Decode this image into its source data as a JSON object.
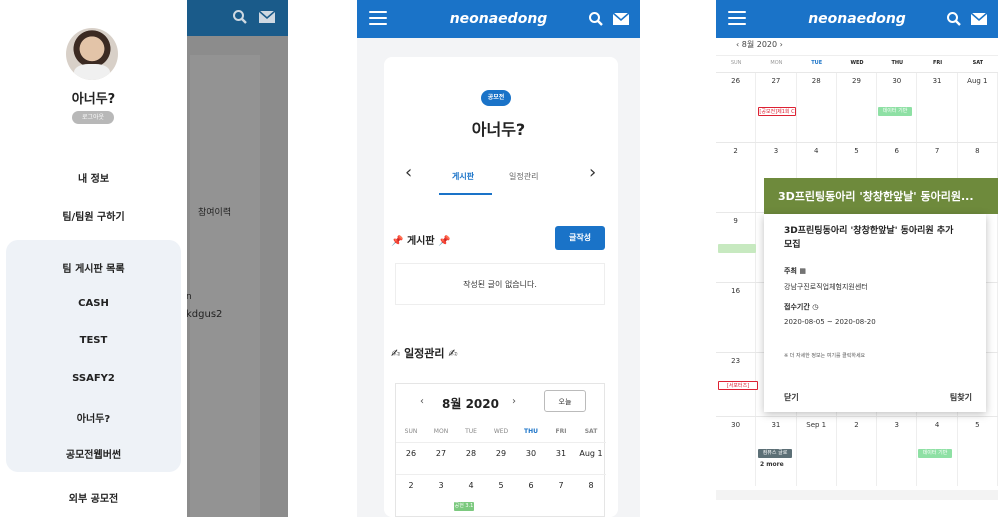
{
  "panel1": {
    "drawer": {
      "user_name": "아너두?",
      "logout_label": "로그아웃",
      "items": [
        "내 정보",
        "팀/팀원 구하기",
        "팀 게시판 목록",
        "CASH",
        "TEST",
        "SSAFY2",
        "아너두?",
        "공모전웹버썬",
        "외부 공모전"
      ]
    },
    "background": {
      "text_1": "참여이력",
      "text_2": "n",
      "text_3": "kdgus2"
    },
    "icons": [
      "search-icon",
      "mail-icon"
    ]
  },
  "panel2": {
    "app_title": "neonaedong",
    "badge": "공모전",
    "team_title": "아너두?",
    "tabs": [
      "게시판",
      "일정관리"
    ],
    "board_heading": "게시판",
    "write_button": "글작성",
    "empty_message": "작성된 글이 없습니다.",
    "schedule_heading": "일정관리",
    "calendar": {
      "prev": "‹",
      "month": "8월 2020",
      "next": "›",
      "today": "오늘",
      "dow": [
        "SUN",
        "MON",
        "TUE",
        "WED",
        "THU",
        "FRI",
        "SAT"
      ],
      "week1": [
        "26",
        "27",
        "28",
        "29",
        "30",
        "31",
        "Aug 1"
      ],
      "week2": [
        "2",
        "3",
        "4",
        "5",
        "6",
        "7",
        "8"
      ],
      "event_label": "공헌 3.1"
    }
  },
  "panel3": {
    "app_title": "neonaedong",
    "subhead": "‹ 8월 2020 ›",
    "dow": [
      "SUN",
      "MON",
      "TUE",
      "WED",
      "THU",
      "FRI",
      "SAT"
    ],
    "weeks": [
      [
        "26",
        "27",
        "28",
        "29",
        "30",
        "31",
        "Aug 1"
      ],
      [
        "2",
        "3",
        "4",
        "5",
        "6",
        "7",
        "8"
      ],
      [
        "9",
        "",
        "",
        "",
        "",
        "",
        ""
      ],
      [
        "16",
        "",
        "",
        "",
        "",
        "",
        ""
      ],
      [
        "23",
        "",
        "",
        "",
        "",
        "",
        ""
      ],
      [
        "30",
        "31",
        "Sep 1",
        "2",
        "3",
        "4",
        "5"
      ]
    ],
    "events": {
      "e1": "[공모전]제1회 C",
      "e2": "데이터 기반",
      "e3": "[서포터즈]",
      "e4": "컴퓨스 글로",
      "e4_more": "2 more",
      "e5": "데이터 기반"
    },
    "popup": {
      "header": "3D프린팅동아리 '창창한앞날' 동아리원...",
      "title": "3D프린팅동아리 '창창한앞날' 동아리원 추가 모집",
      "host_label": "주최",
      "host_value": "강남구진로직업체험지원센터",
      "period_label": "접수기간",
      "period_value": "2020-08-05 ~ 2020-08-20",
      "note": "※ 더 자세한 정보는 여기를 클릭하세요",
      "close": "닫기",
      "find_team": "팀찾기"
    }
  },
  "colors": {
    "primary": "#1a73c8",
    "popup_header": "#6e8a3c"
  }
}
